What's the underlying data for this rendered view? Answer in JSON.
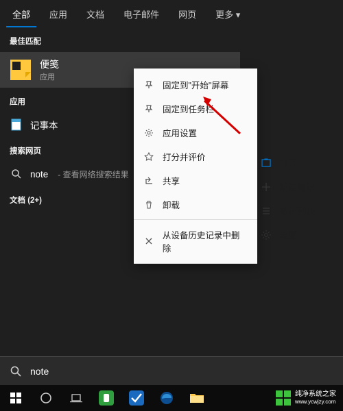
{
  "tabs": [
    "全部",
    "应用",
    "文档",
    "电子邮件",
    "网页",
    "更多 ▾"
  ],
  "active_tab": 0,
  "sections": {
    "best_match": "最佳匹配",
    "apps": "应用",
    "web": "搜索网页",
    "docs": "文档 (2+)"
  },
  "best": {
    "title": "便笺",
    "sub": "应用"
  },
  "app_item": {
    "title": "记事本"
  },
  "web_item": {
    "prefix": "note",
    "sub": "- 查看网络搜索结果"
  },
  "context": {
    "pin_start": "固定到\"开始\"屏幕",
    "pin_taskbar": "固定到任务栏",
    "app_settings": "应用设置",
    "rate": "打分并评价",
    "share": "共享",
    "uninstall": "卸载",
    "remove_history": "从设备历史记录中删除"
  },
  "right_actions": {
    "open": "打开",
    "new_note": "新建笔记",
    "note_list": "笔记列表",
    "settings": "设置"
  },
  "search": {
    "value": "note"
  },
  "watermark": {
    "line1": "纯净系统之家",
    "line2": "www.ycwjzy.com"
  }
}
